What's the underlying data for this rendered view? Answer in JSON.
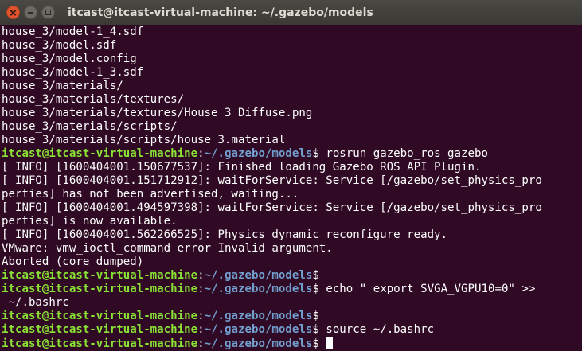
{
  "window": {
    "title": "itcast@itcast-virtual-machine: ~/.gazebo/models",
    "buttons": {
      "close": "close-icon",
      "minimize": "minimize-icon",
      "maximize": "maximize-icon"
    }
  },
  "colors": {
    "background": "#300a24",
    "prompt_user": "#8ae234",
    "prompt_path": "#729fcf",
    "text": "#ffffff"
  },
  "terminal": {
    "lines": [
      {
        "type": "output",
        "text": "house_3/model-1_4.sdf"
      },
      {
        "type": "output",
        "text": "house_3/model.sdf"
      },
      {
        "type": "output",
        "text": "house_3/model.config"
      },
      {
        "type": "output",
        "text": "house_3/model-1_3.sdf"
      },
      {
        "type": "output",
        "text": "house_3/materials/"
      },
      {
        "type": "output",
        "text": "house_3/materials/textures/"
      },
      {
        "type": "output",
        "text": "house_3/materials/textures/House_3_Diffuse.png"
      },
      {
        "type": "output",
        "text": "house_3/materials/scripts/"
      },
      {
        "type": "output",
        "text": "house_3/materials/scripts/house_3.material"
      },
      {
        "type": "prompt",
        "user": "itcast@itcast-virtual-machine",
        "sep": ":",
        "path": "~/.gazebo/models",
        "sym": "$ ",
        "cmd": "rosrun gazebo_ros gazebo"
      },
      {
        "type": "output",
        "text": "[ INFO] [1600404001.150677537]: Finished loading Gazebo ROS API Plugin."
      },
      {
        "type": "output",
        "text": "[ INFO] [1600404001.151712912]: waitForService: Service [/gazebo/set_physics_pro"
      },
      {
        "type": "output",
        "text": "perties] has not been advertised, waiting..."
      },
      {
        "type": "output",
        "text": "[ INFO] [1600404001.494597398]: waitForService: Service [/gazebo/set_physics_pro"
      },
      {
        "type": "output",
        "text": "perties] is now available."
      },
      {
        "type": "output",
        "text": "[ INFO] [1600404001.562266525]: Physics dynamic reconfigure ready."
      },
      {
        "type": "output",
        "text": "VMware: vmw_ioctl_command error Invalid argument."
      },
      {
        "type": "output",
        "text": "Aborted (core dumped)"
      },
      {
        "type": "prompt",
        "user": "itcast@itcast-virtual-machine",
        "sep": ":",
        "path": "~/.gazebo/models",
        "sym": "$",
        "cmd": ""
      },
      {
        "type": "prompt",
        "user": "itcast@itcast-virtual-machine",
        "sep": ":",
        "path": "~/.gazebo/models",
        "sym": "$ ",
        "cmd": "echo \" export SVGA_VGPU10=0\" >>"
      },
      {
        "type": "output",
        "text": " ~/.bashrc"
      },
      {
        "type": "prompt",
        "user": "itcast@itcast-virtual-machine",
        "sep": ":",
        "path": "~/.gazebo/models",
        "sym": "$",
        "cmd": ""
      },
      {
        "type": "prompt",
        "user": "itcast@itcast-virtual-machine",
        "sep": ":",
        "path": "~/.gazebo/models",
        "sym": "$ ",
        "cmd": "source ~/.bashrc"
      },
      {
        "type": "prompt",
        "user": "itcast@itcast-virtual-machine",
        "sep": ":",
        "path": "~/.gazebo/models",
        "sym": "$ ",
        "cmd": "",
        "cursor": true
      }
    ]
  }
}
